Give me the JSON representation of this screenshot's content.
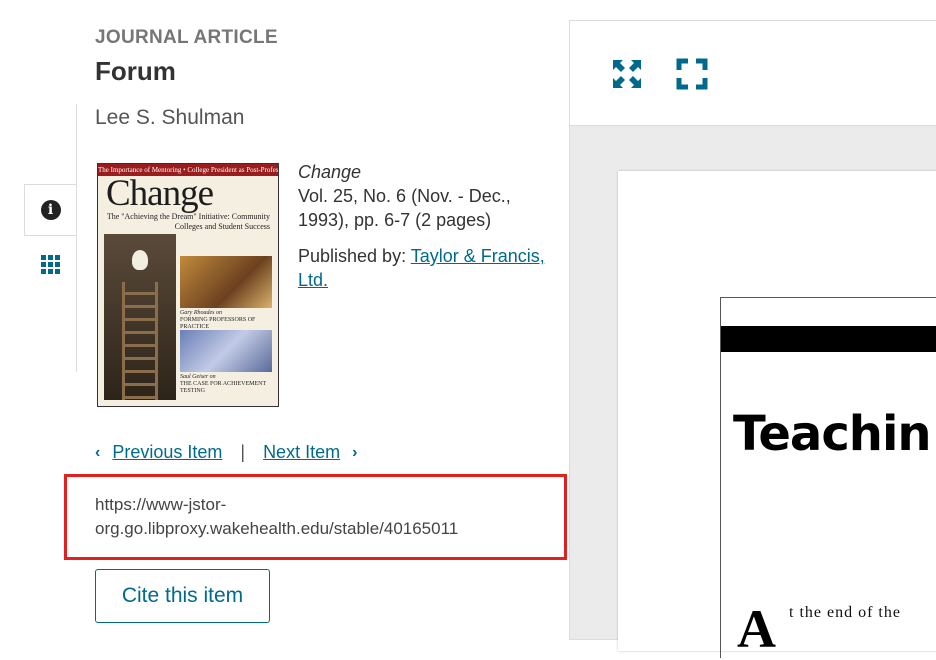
{
  "article": {
    "type_label": "JOURNAL ARTICLE",
    "title": "Forum",
    "author": "Lee S. Shulman"
  },
  "cover": {
    "top_strip": "The Importance of Mentoring • College President as Post-Professor",
    "masthead": "Change",
    "headline": "The \"Achieving the Dream\" Initiative: Community Colleges and Student Success",
    "story2_byline": "Gary Rhoades on",
    "story2": "Forming Professors of Practice",
    "story3_byline": "Saul Geiser on",
    "story3": "The Case for Achievement Testing"
  },
  "journal": {
    "name": "Change",
    "issue": "Vol. 25, No. 6 (Nov. - Dec., 1993), pp. 6-7 (2 pages)",
    "publisher_prefix": "Published by: ",
    "publisher": "Taylor & Francis, Ltd."
  },
  "nav": {
    "previous": "Previous Item",
    "separator": "|",
    "next": "Next Item"
  },
  "stable_url": "https://www-jstor-org.go.libproxy.wakehealth.edu/stable/40165011",
  "cite_button": "Cite this item",
  "viewer": {
    "page_heading": "Teachin",
    "drop_cap": "A",
    "body_line": "t the end of the"
  },
  "icons": {
    "info_tab": "info-icon",
    "contents_tab": "grid-icon",
    "fit_page": "collapse-arrows-icon",
    "fullscreen": "fullscreen-icon"
  },
  "colors": {
    "accent": "#006a8d",
    "highlight": "#e0211f",
    "muted": "#767676"
  }
}
